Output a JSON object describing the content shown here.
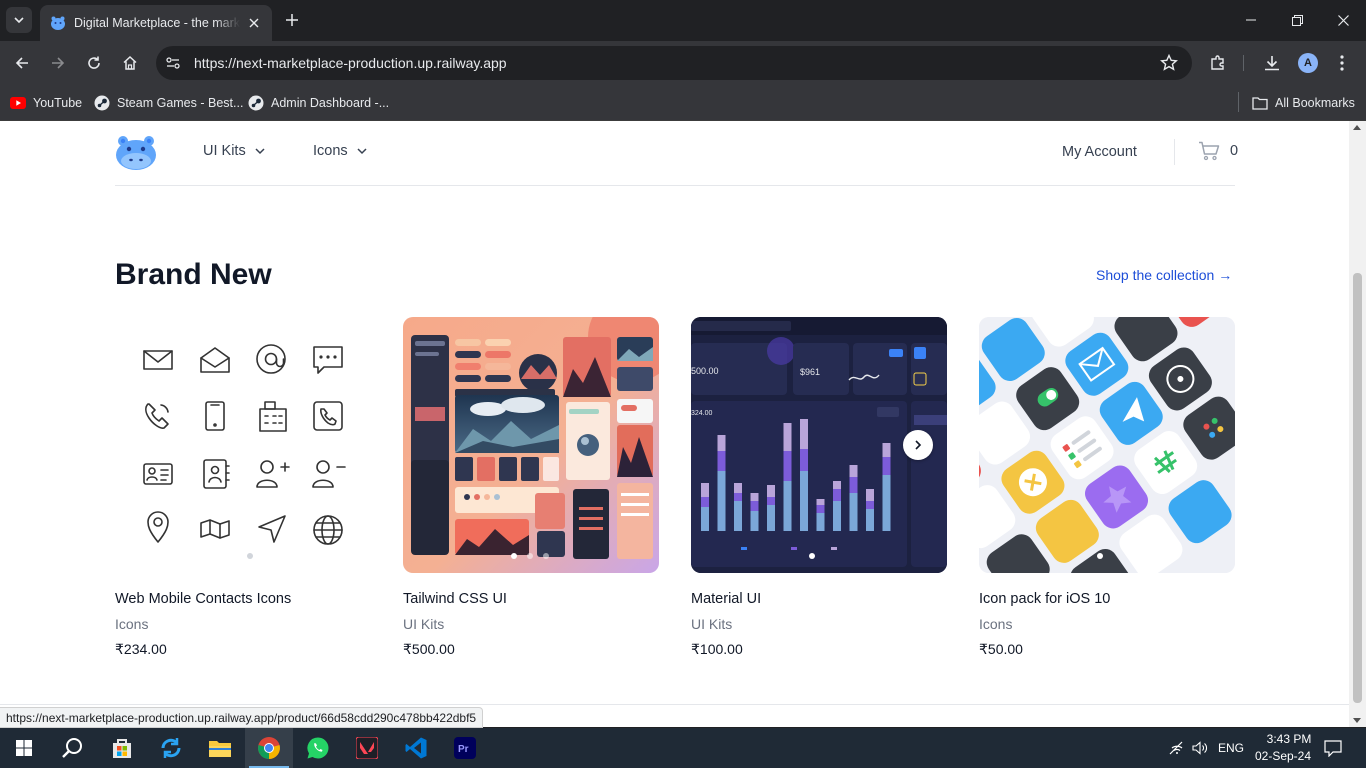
{
  "browser": {
    "tab_title": "Digital Marketplace - the marketplace for high-quality digital goods",
    "url": "https://next-marketplace-production.up.railway.app",
    "avatar_letter": "A",
    "bookmarks": [
      {
        "label": "YouTube",
        "icon": "youtube-icon"
      },
      {
        "label": "Steam Games - Best...",
        "icon": "steam-icon"
      },
      {
        "label": "Admin Dashboard -...",
        "icon": "steam-icon"
      }
    ],
    "all_bookmarks": "All Bookmarks",
    "status_url": "https://next-marketplace-production.up.railway.app/product/66d58cdd290c478bb422dbf5"
  },
  "header": {
    "nav": [
      {
        "label": "UI Kits"
      },
      {
        "label": "Icons"
      }
    ],
    "account": "My Account",
    "cart_count": "0"
  },
  "section": {
    "title": "Brand New",
    "link": "Shop the collection →"
  },
  "products": [
    {
      "name": "Web Mobile Contacts Icons",
      "category": "Icons",
      "price": "₹234.00"
    },
    {
      "name": "Tailwind CSS UI",
      "category": "UI Kits",
      "price": "₹500.00"
    },
    {
      "name": "Material UI",
      "category": "UI Kits",
      "price": "₹100.00"
    },
    {
      "name": "Icon pack for iOS 10",
      "category": "Icons",
      "price": "₹50.00"
    }
  ],
  "material_preview": {
    "amount_1": "500.00",
    "amount_2": "$961",
    "amount_3": "324.00"
  },
  "taskbar": {
    "time": "3:43 PM",
    "date": "02-Sep-24",
    "lang": "ENG"
  },
  "colors": {
    "link": "#1d4ed8",
    "brand_logo": "#60a5fa"
  }
}
